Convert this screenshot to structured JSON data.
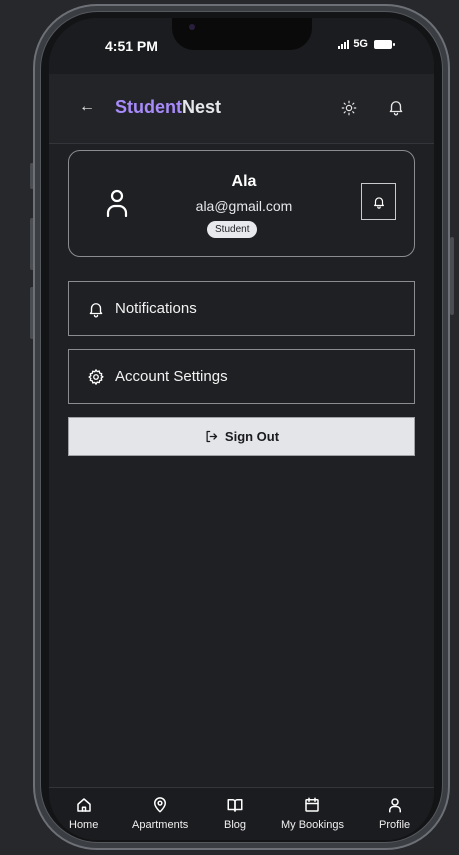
{
  "status": {
    "time": "4:51 PM",
    "network": "5G"
  },
  "appbar": {
    "brand_part1": "Student",
    "brand_part2": "Nest"
  },
  "profile": {
    "name": "Ala",
    "email": "ala@gmail.com",
    "role": "Student"
  },
  "menu": {
    "notifications_label": "Notifications",
    "account_settings_label": "Account Settings",
    "sign_out_label": "Sign Out"
  },
  "nav": [
    {
      "label": "Home",
      "icon": "home-icon"
    },
    {
      "label": "Apartments",
      "icon": "map-pin-icon"
    },
    {
      "label": "Blog",
      "icon": "book-open-icon"
    },
    {
      "label": "My Bookings",
      "icon": "calendar-icon"
    },
    {
      "label": "Profile",
      "icon": "user-icon"
    }
  ],
  "colors": {
    "accent": "#a78bfa",
    "background": "#1f2023",
    "button_light": "#e4e5e9"
  }
}
